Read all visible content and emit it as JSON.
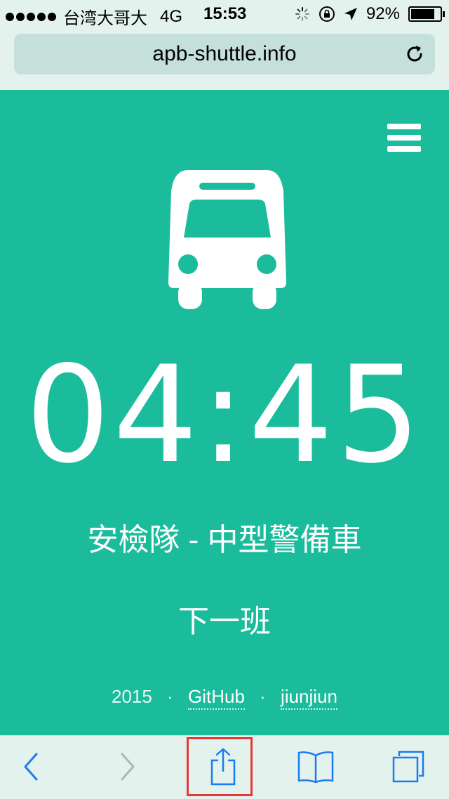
{
  "status_bar": {
    "carrier": "台湾大哥大",
    "network": "4G",
    "time": "15:53",
    "battery_percent": "92%",
    "battery_level": 0.92
  },
  "browser": {
    "url": "apb-shuttle.info"
  },
  "app": {
    "countdown": "04:45",
    "route": "安檢隊 - 中型警備車",
    "next_label": "下一班",
    "footer": {
      "year": "2015",
      "separator": "·",
      "github": "GitHub",
      "author": "jiunjiun"
    }
  },
  "colors": {
    "accent": "#1abc9c",
    "ios_blue": "#1a7cf0",
    "highlight": "#e53935"
  },
  "icons": [
    "signal-dots",
    "activity-spinner-icon",
    "rotation-lock-icon",
    "location-arrow-icon",
    "battery-icon",
    "reload-icon",
    "menu-icon",
    "bus-icon",
    "back-icon",
    "forward-icon",
    "share-icon",
    "bookmarks-icon",
    "tabs-icon"
  ]
}
